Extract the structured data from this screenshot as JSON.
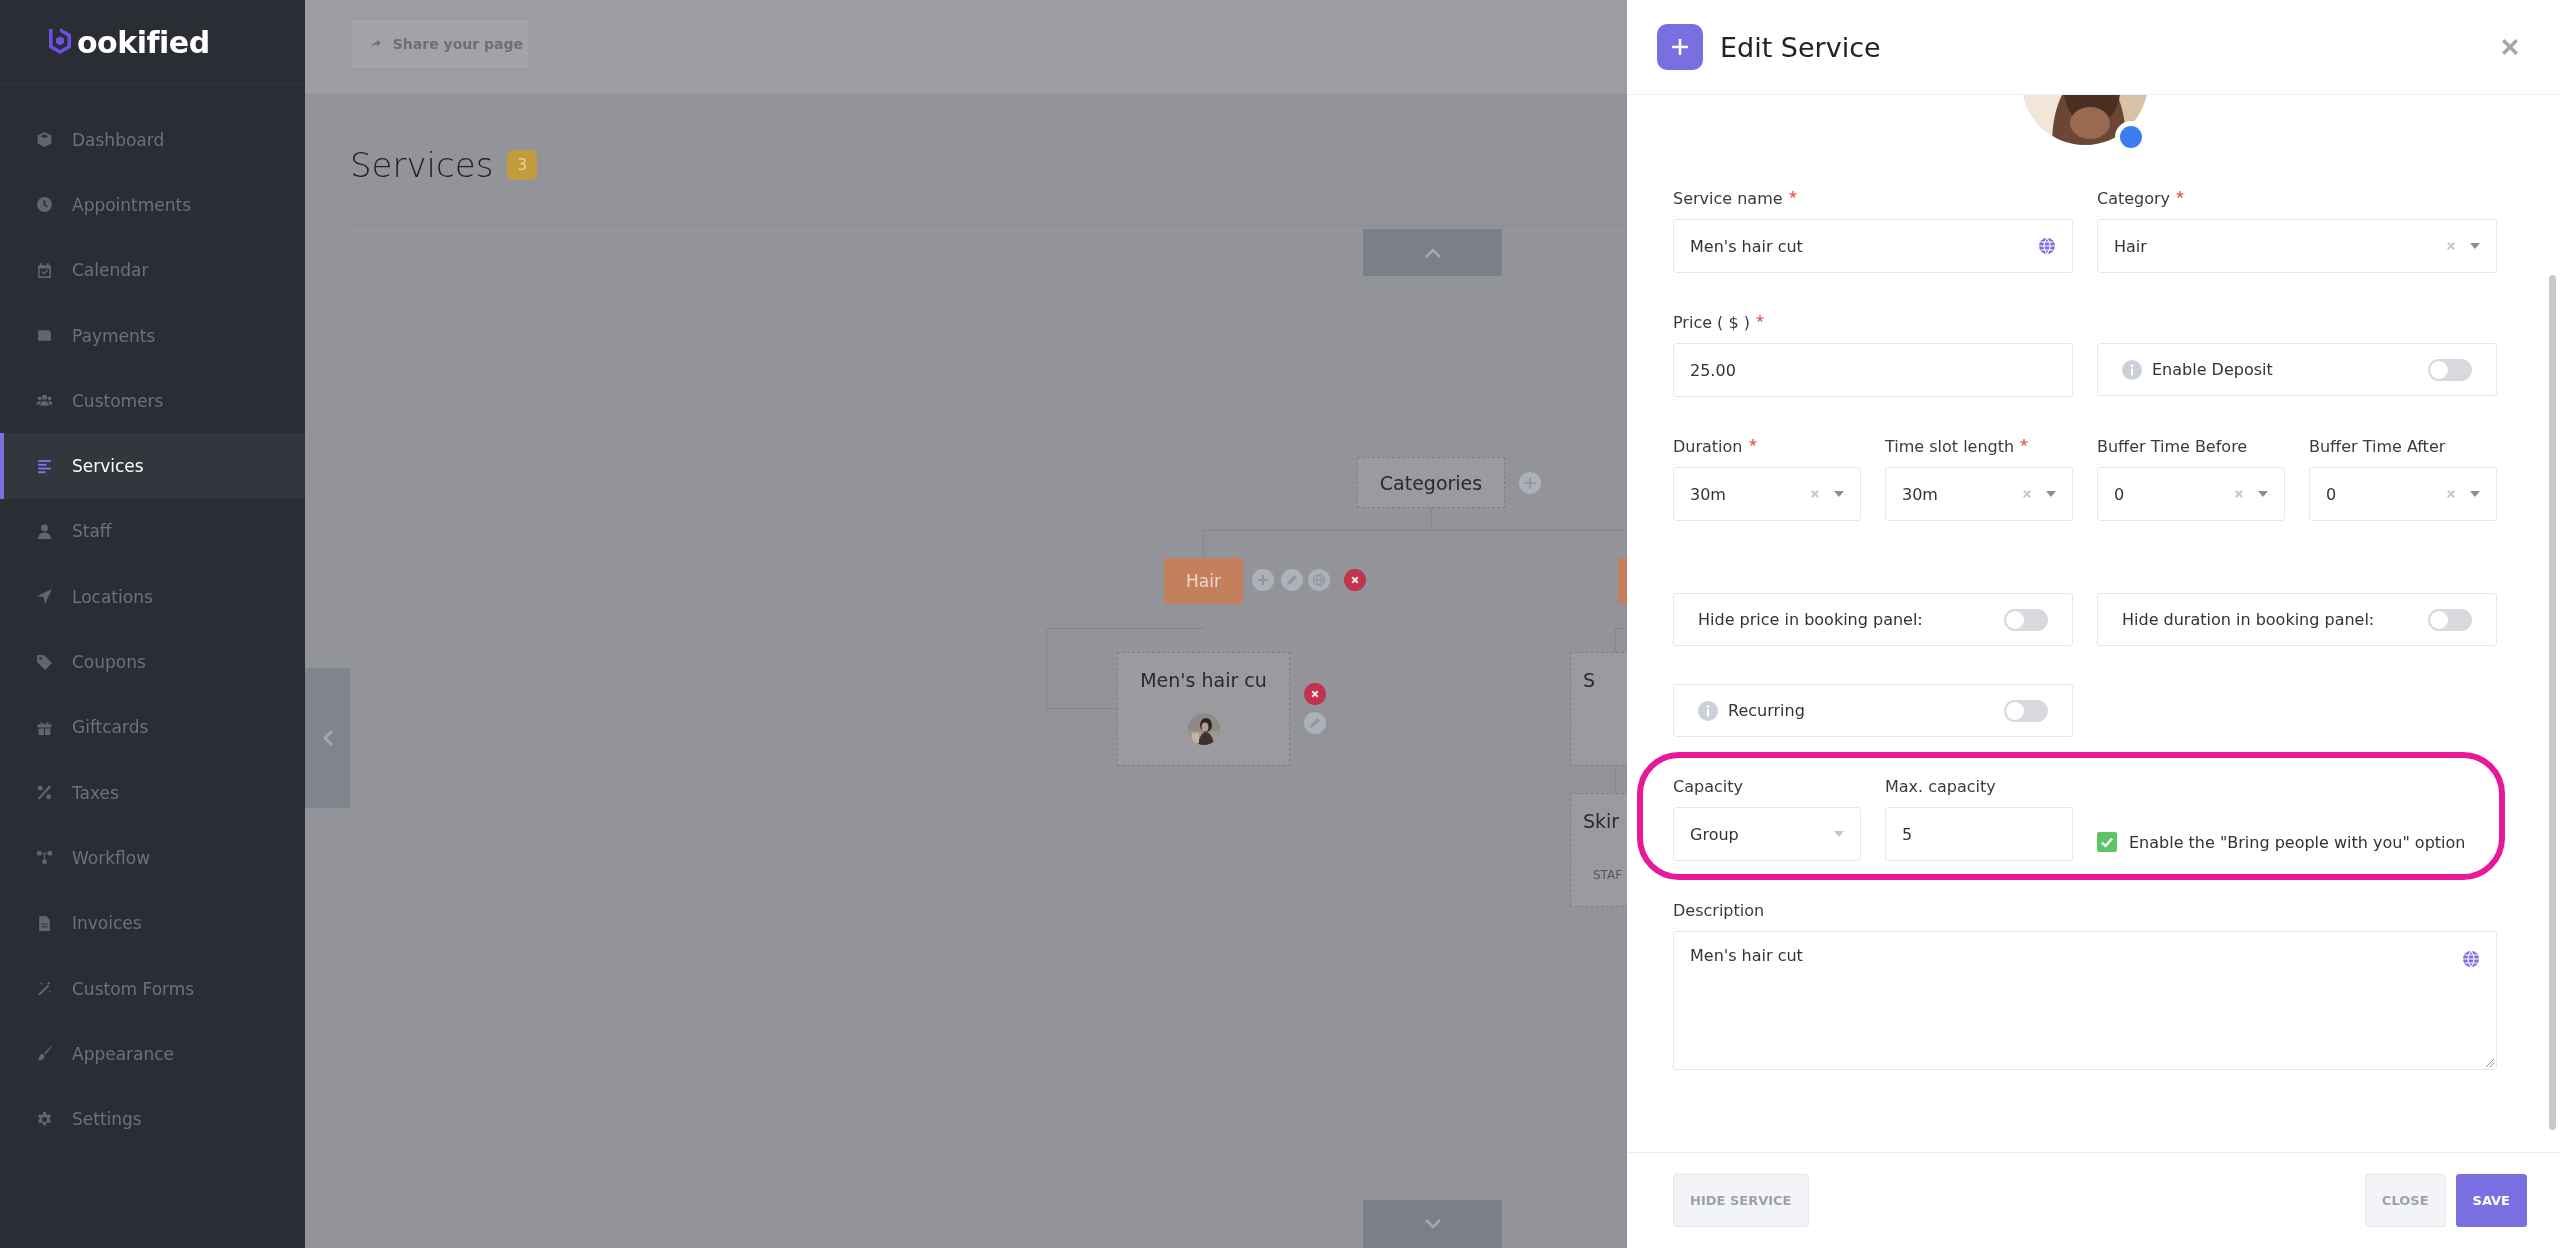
{
  "sidebar": {
    "logo": "ookified",
    "items": [
      {
        "label": "Dashboard",
        "selected": false
      },
      {
        "label": "Appointments",
        "selected": false
      },
      {
        "label": "Calendar",
        "selected": false
      },
      {
        "label": "Payments",
        "selected": false
      },
      {
        "label": "Customers",
        "selected": false
      },
      {
        "label": "Services",
        "selected": true
      },
      {
        "label": "Staff",
        "selected": false
      },
      {
        "label": "Locations",
        "selected": false
      },
      {
        "label": "Coupons",
        "selected": false
      },
      {
        "label": "Giftcards",
        "selected": false
      },
      {
        "label": "Taxes",
        "selected": false
      },
      {
        "label": "Workflow",
        "selected": false
      },
      {
        "label": "Invoices",
        "selected": false
      },
      {
        "label": "Custom Forms",
        "selected": false
      },
      {
        "label": "Appearance",
        "selected": false
      },
      {
        "label": "Settings",
        "selected": false
      }
    ]
  },
  "top_bar": {
    "share_button": "Share your page"
  },
  "page": {
    "title": "Services",
    "count": "3"
  },
  "org_chart": {
    "root": "Categories",
    "category": "Hair",
    "services": [
      {
        "name": "Men's hair cu",
        "kind": "avatar"
      },
      {
        "name": "S",
        "kind": "plain"
      },
      {
        "name": "Skir",
        "kind": "staff",
        "staff_label": "STAF"
      }
    ]
  },
  "dialog": {
    "title": "Edit Service",
    "rows": [
      {
        "highlighted": false,
        "cells": [
          {
            "kind": "input",
            "label": "Service name",
            "required": true,
            "value": "Men's hair cut",
            "translatable": true
          },
          {
            "kind": "select",
            "label": "Category",
            "required": true,
            "value": "Hair",
            "clearable": true
          }
        ]
      },
      {
        "highlighted": false,
        "cells": [
          {
            "kind": "input",
            "label": "Price ( $ )",
            "required": true,
            "value": "25.00",
            "translatable": false
          },
          {
            "kind": "toggle",
            "text": "Enable Deposit",
            "info": true,
            "on": false
          }
        ]
      },
      {
        "highlighted": false,
        "cells": [
          {
            "kind": "select",
            "label": "Duration",
            "required": true,
            "value": "30m",
            "clearable": true
          },
          {
            "kind": "select",
            "label": "Time slot length",
            "required": true,
            "value": "30m",
            "clearable": true
          },
          {
            "kind": "select",
            "label": "Buffer Time Before",
            "required": false,
            "value": "0",
            "clearable": true
          },
          {
            "kind": "select",
            "label": "Buffer Time After",
            "required": false,
            "value": "0",
            "clearable": true
          }
        ]
      },
      {
        "highlighted": false,
        "cells": [
          {
            "kind": "toggle",
            "text": "Hide price in booking panel:",
            "info": false,
            "on": false
          },
          {
            "kind": "toggle",
            "text": "Hide duration in booking panel:",
            "info": false,
            "on": false
          }
        ]
      },
      {
        "highlighted": false,
        "cells": [
          {
            "kind": "toggle",
            "text": "Recurring",
            "info": true,
            "on": false
          }
        ]
      },
      {
        "highlighted": true,
        "cells": [
          {
            "kind": "select",
            "label": "Capacity",
            "required": false,
            "value": "Group",
            "clearable": false
          },
          {
            "kind": "input",
            "label": "Max. capacity",
            "required": false,
            "value": "5",
            "translatable": false
          },
          {
            "kind": "checkbox",
            "text": "Enable the \"Bring people with you\" option",
            "checked": true
          }
        ]
      },
      {
        "highlighted": false,
        "cells": [
          {
            "kind": "textarea",
            "label": "Description",
            "required": false,
            "value": "Men's hair cut",
            "translatable": true
          }
        ]
      }
    ],
    "buttons": [
      {
        "label": "HIDE SERVICE",
        "kind": "secondary"
      },
      {
        "label": "CLOSE",
        "kind": "secondary"
      },
      {
        "label": "SAVE",
        "kind": "primary"
      }
    ]
  }
}
